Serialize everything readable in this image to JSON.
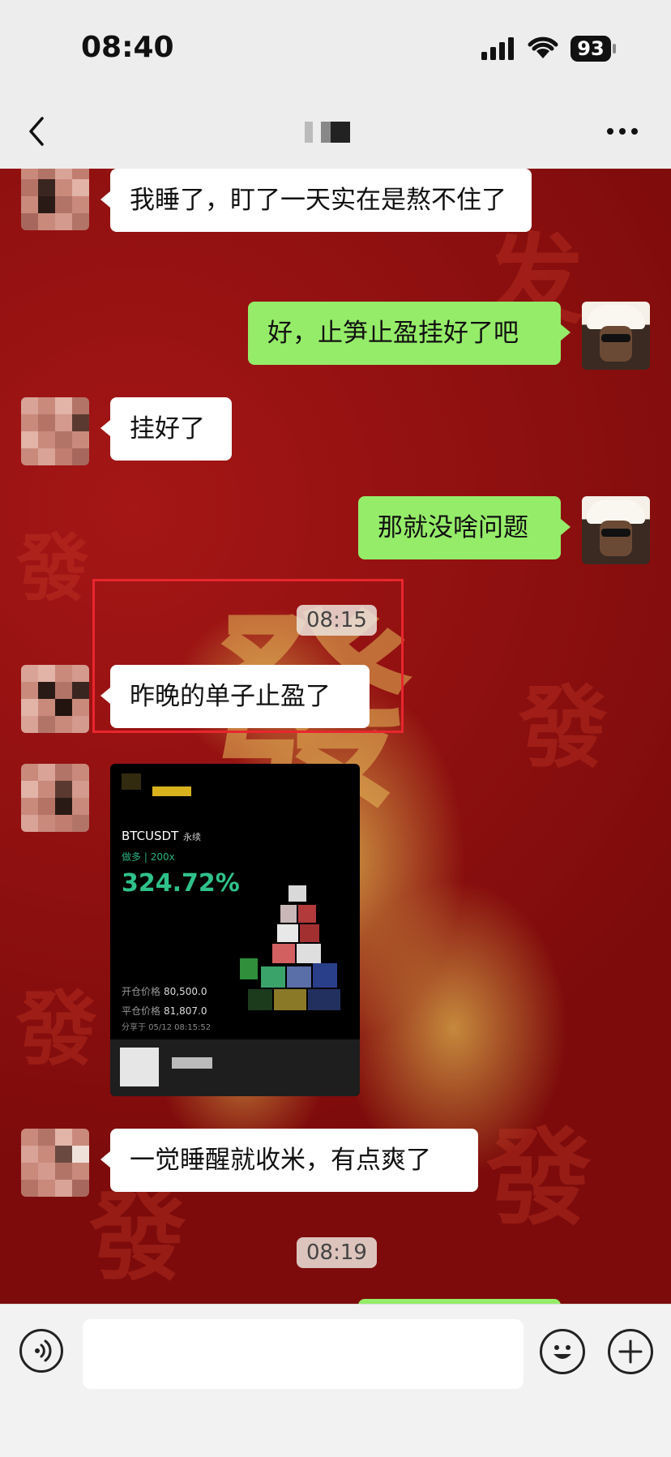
{
  "status_bar": {
    "time": "08:40",
    "battery": "93"
  },
  "header": {
    "back_icon": "chevron-left-icon",
    "more_icon": "ellipsis-icon"
  },
  "messages": [
    {
      "side": "in",
      "text": "我睡了，盯了一天实在是熬不住了"
    },
    {
      "side": "out",
      "text": "好，止笋止盈挂好了吧"
    },
    {
      "side": "in",
      "text": "挂好了"
    },
    {
      "side": "out",
      "text": "那就没啥问题"
    },
    {
      "timestamp": "08:15"
    },
    {
      "side": "in",
      "text": "昨晚的单子止盈了"
    },
    {
      "side": "in",
      "type": "image-card"
    },
    {
      "side": "in",
      "text": "一觉睡醒就收米，有点爽了"
    },
    {
      "timestamp": "08:19"
    }
  ],
  "trade_card": {
    "pair": "BTCUSDT",
    "contract": "永续",
    "direction": "做多",
    "leverage": "200x",
    "pnl_percent": "324.72%",
    "open_price_label": "开仓价格",
    "open_price": "80,500.0",
    "close_price_label": "平仓价格",
    "close_price": "81,807.0",
    "share_time": "分享于 05/12 08:15:52"
  },
  "theme": {
    "bubble_out": "#95ec69",
    "bubble_in": "#ffffff",
    "highlight": "#e8262e",
    "pnl_green": "#2ec28a"
  }
}
